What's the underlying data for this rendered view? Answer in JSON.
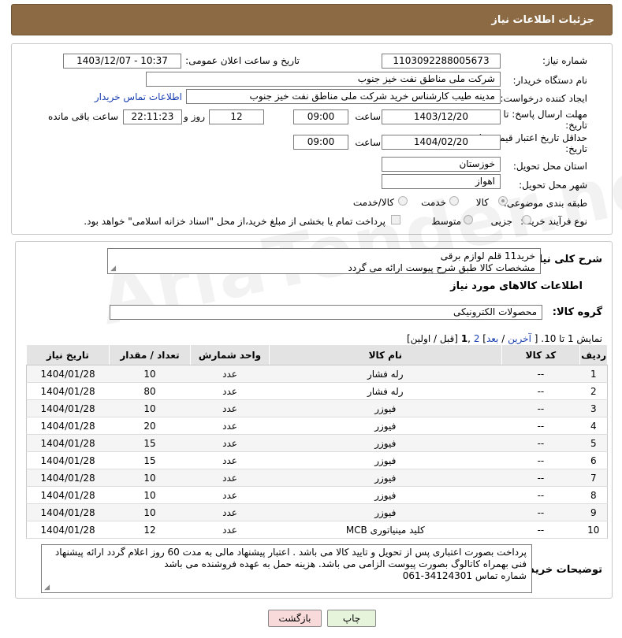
{
  "header": {
    "title": "جزئیات اطلاعات نیاز"
  },
  "form": {
    "need_number_label": "شماره نیاز:",
    "need_number": "1103092288005673",
    "announce_label": "تاریخ و ساعت اعلان عمومی:",
    "announce_value": "1403/12/07 - 10:37",
    "buyer_org_label": "نام دستگاه خریدار:",
    "buyer_org": "شرکت ملی مناطق نفت خیز جنوب",
    "requester_label": "ایجاد کننده درخواست:",
    "requester": "مدینه طیب کارشناس خرید شرکت ملی مناطق نفت خیز جنوب",
    "contact_link": "اطلاعات تماس خریدار",
    "reply_deadline_label_1": "مهلت ارسال پاسخ: تا",
    "reply_deadline_label_2": "تاریخ:",
    "reply_date": "1403/12/20",
    "time_label": "ساعت",
    "reply_time": "09:00",
    "days_value": "12",
    "days_label": "روز و",
    "remaining_time": "22:11:23",
    "remaining_label": "ساعت باقی مانده",
    "price_validity_label_1": "حداقل تاریخ اعتبار قیمت: تا",
    "price_validity_label_2": "تاریخ:",
    "validity_date": "1404/02/20",
    "validity_time": "09:00",
    "province_label": "استان محل تحویل:",
    "province": "خوزستان",
    "city_label": "شهر محل تحویل:",
    "city": "اهواز",
    "category_label": "طبقه بندی موضوعی:",
    "category_options": [
      "کالا",
      "خدمت",
      "کالا/خدمت"
    ],
    "purchase_type_label": "نوع فرآیند خرید :",
    "purchase_options": [
      "جزیی",
      "متوسط"
    ],
    "payment_note": "پرداخت تمام یا بخشی از مبلغ خرید،از محل \"اسناد خزانه اسلامی\" خواهد بود."
  },
  "details": {
    "summary_label": "شرح کلی نیاز:",
    "summary_line1": "خرید11 قلم لوازم برقی",
    "summary_line2": "مشخصات کالا طبق شرح پیوست ارائه می گردد",
    "goods_info_title": "اطلاعات کالاهای مورد نیاز",
    "goods_group_label": "گروه کالا:",
    "goods_group": "محصولات الکترونیکی",
    "pager": {
      "prefix": "نمایش 1 تا 10. [",
      "last": "آخرین",
      "next": "بعد",
      "page2": "2",
      "page1": "1",
      "suffix": "[قبل / اولین]"
    }
  },
  "table": {
    "headers": [
      "ردیف",
      "کد کالا",
      "نام کالا",
      "واحد شمارش",
      "تعداد / مقدار",
      "تاریخ نیاز"
    ],
    "rows": [
      [
        "1",
        "--",
        "رله فشار",
        "عدد",
        "10",
        "1404/01/28"
      ],
      [
        "2",
        "--",
        "رله فشار",
        "عدد",
        "80",
        "1404/01/28"
      ],
      [
        "3",
        "--",
        "فیوزر",
        "عدد",
        "10",
        "1404/01/28"
      ],
      [
        "4",
        "--",
        "فیوزر",
        "عدد",
        "20",
        "1404/01/28"
      ],
      [
        "5",
        "--",
        "فیوزر",
        "عدد",
        "15",
        "1404/01/28"
      ],
      [
        "6",
        "--",
        "فیوزر",
        "عدد",
        "15",
        "1404/01/28"
      ],
      [
        "7",
        "--",
        "فیوزر",
        "عدد",
        "10",
        "1404/01/28"
      ],
      [
        "8",
        "--",
        "فیوزر",
        "عدد",
        "10",
        "1404/01/28"
      ],
      [
        "9",
        "--",
        "فیوزر",
        "عدد",
        "10",
        "1404/01/28"
      ],
      [
        "10",
        "--",
        "کلید مینیاتوری MCB",
        "عدد",
        "12",
        "1404/01/28"
      ]
    ]
  },
  "notes": {
    "label": "توضیحات خریدار:",
    "line1": "پرداخت بصورت اعتباری پس از تحویل و تایید کالا می باشد . اعتبار پیشنهاد مالی به مدت 60 روز اعلام گردد  ارائه پیشنهاد",
    "line2": "فنی بهمراه کاتالوگ بصورت پیوست الزامی می باشد. هزینه حمل به عهده فروشنده می باشد",
    "line3": "شماره تماس 34124301-061"
  },
  "buttons": {
    "print": "چاپ",
    "back": "بازگشت"
  }
}
